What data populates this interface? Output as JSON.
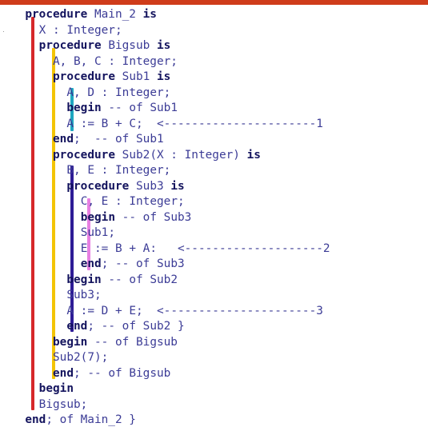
{
  "colors": {
    "top_rule": "#cf3c1b",
    "keyword": "#14145e",
    "text": "#3c3c96",
    "scope_main_2": "#d6282a",
    "scope_bigsub": "#f3c404",
    "scope_sub1": "#1ea6c0",
    "scope_sub2": "#2e1b96",
    "scope_sub3": "#e87fe3"
  },
  "code_lines": [
    {
      "indent": 2,
      "segments": [
        {
          "kind": "kw",
          "text": "procedure"
        },
        {
          "kind": "tx",
          "text": " Main_2 "
        },
        {
          "kind": "kw",
          "text": "is"
        }
      ]
    },
    {
      "indent": 4,
      "segments": [
        {
          "kind": "tx",
          "text": "X : Integer;"
        }
      ]
    },
    {
      "indent": 4,
      "segments": [
        {
          "kind": "kw",
          "text": "procedure"
        },
        {
          "kind": "tx",
          "text": " Bigsub "
        },
        {
          "kind": "kw",
          "text": "is"
        }
      ]
    },
    {
      "indent": 6,
      "segments": [
        {
          "kind": "tx",
          "text": "A, B, C : Integer;"
        }
      ]
    },
    {
      "indent": 6,
      "segments": [
        {
          "kind": "kw",
          "text": "procedure"
        },
        {
          "kind": "tx",
          "text": " Sub1 "
        },
        {
          "kind": "kw",
          "text": "is"
        }
      ]
    },
    {
      "indent": 8,
      "segments": [
        {
          "kind": "tx",
          "text": "A, D : Integer;"
        }
      ]
    },
    {
      "indent": 8,
      "segments": [
        {
          "kind": "kw",
          "text": "begin"
        },
        {
          "kind": "tx",
          "text": " -- of Sub1"
        }
      ]
    },
    {
      "indent": 8,
      "segments": [
        {
          "kind": "tx",
          "text": "A := B + C;  <----------------------1"
        }
      ]
    },
    {
      "indent": 6,
      "segments": [
        {
          "kind": "kw",
          "text": "end"
        },
        {
          "kind": "tx",
          "text": ";  -- of Sub1"
        }
      ]
    },
    {
      "indent": 6,
      "segments": [
        {
          "kind": "kw",
          "text": "procedure"
        },
        {
          "kind": "tx",
          "text": " Sub2(X : Integer) "
        },
        {
          "kind": "kw",
          "text": "is"
        }
      ]
    },
    {
      "indent": 8,
      "segments": [
        {
          "kind": "tx",
          "text": "B, E : Integer;"
        }
      ]
    },
    {
      "indent": 8,
      "segments": [
        {
          "kind": "kw",
          "text": "procedure"
        },
        {
          "kind": "tx",
          "text": " Sub3 "
        },
        {
          "kind": "kw",
          "text": "is"
        }
      ]
    },
    {
      "indent": 10,
      "segments": [
        {
          "kind": "tx",
          "text": "C, E : Integer;"
        }
      ]
    },
    {
      "indent": 10,
      "segments": [
        {
          "kind": "kw",
          "text": "begin"
        },
        {
          "kind": "tx",
          "text": " -- of Sub3"
        }
      ]
    },
    {
      "indent": 10,
      "segments": [
        {
          "kind": "tx",
          "text": "Sub1;"
        }
      ]
    },
    {
      "indent": 10,
      "segments": [
        {
          "kind": "tx",
          "text": "E := B + A:   <--------------------2"
        }
      ]
    },
    {
      "indent": 10,
      "segments": [
        {
          "kind": "kw",
          "text": "end"
        },
        {
          "kind": "tx",
          "text": "; -- of Sub3"
        }
      ]
    },
    {
      "indent": 8,
      "segments": [
        {
          "kind": "kw",
          "text": "begin"
        },
        {
          "kind": "tx",
          "text": " -- of Sub2"
        }
      ]
    },
    {
      "indent": 8,
      "segments": [
        {
          "kind": "tx",
          "text": "Sub3;"
        }
      ]
    },
    {
      "indent": 8,
      "segments": [
        {
          "kind": "tx",
          "text": "A := D + E;  <----------------------3"
        }
      ]
    },
    {
      "indent": 8,
      "segments": [
        {
          "kind": "kw",
          "text": "end"
        },
        {
          "kind": "tx",
          "text": "; -- of Sub2 }"
        }
      ]
    },
    {
      "indent": 6,
      "segments": [
        {
          "kind": "kw",
          "text": "begin"
        },
        {
          "kind": "tx",
          "text": " -- of Bigsub"
        }
      ]
    },
    {
      "indent": 6,
      "segments": [
        {
          "kind": "tx",
          "text": "Sub2(7);"
        }
      ]
    },
    {
      "indent": 6,
      "segments": [
        {
          "kind": "kw",
          "text": "end"
        },
        {
          "kind": "tx",
          "text": "; -- of Bigsub"
        }
      ]
    },
    {
      "indent": 4,
      "segments": [
        {
          "kind": "kw",
          "text": "begin"
        }
      ]
    },
    {
      "indent": 4,
      "segments": [
        {
          "kind": "tx",
          "text": "Bigsub;"
        }
      ]
    },
    {
      "indent": 2,
      "segments": [
        {
          "kind": "kw",
          "text": "end"
        },
        {
          "kind": "tx",
          "text": "; of Main_2 }"
        }
      ]
    }
  ]
}
